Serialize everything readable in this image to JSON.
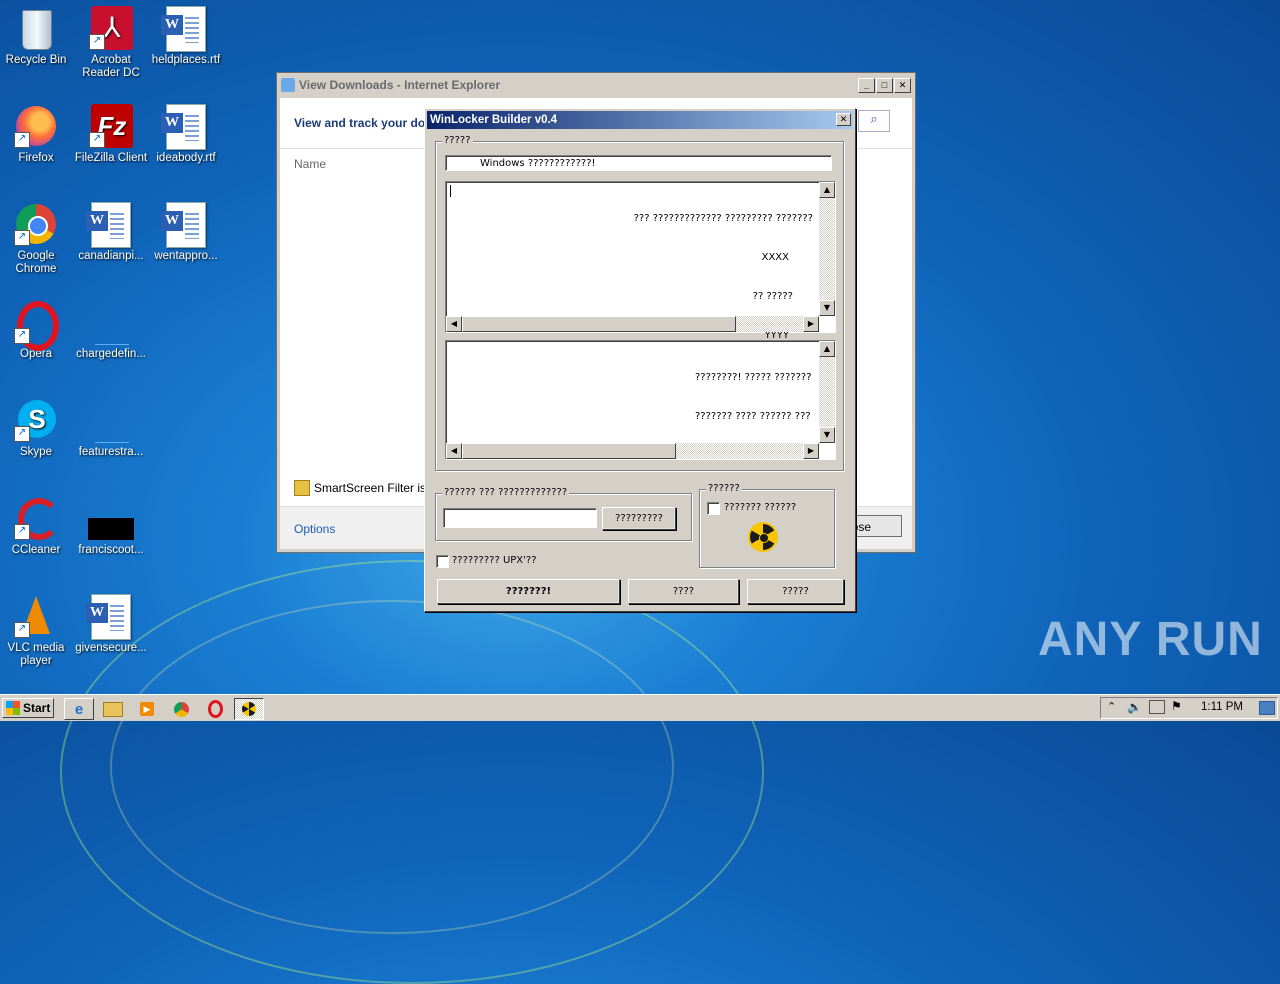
{
  "desktop": {
    "icons": [
      {
        "label": "Recycle Bin",
        "icon": "recycle-bin-icon"
      },
      {
        "label": "Acrobat Reader DC",
        "icon": "acrobat-icon"
      },
      {
        "label": "heldplaces.rtf",
        "icon": "word-document-icon"
      },
      {
        "label": "Firefox",
        "icon": "firefox-icon"
      },
      {
        "label": "FileZilla Client",
        "icon": "filezilla-icon"
      },
      {
        "label": "ideabody.rtf",
        "icon": "word-document-icon"
      },
      {
        "label": "Google Chrome",
        "icon": "chrome-icon"
      },
      {
        "label": "canadianpi...",
        "icon": "word-document-icon"
      },
      {
        "label": "wentappro...",
        "icon": "word-document-icon"
      },
      {
        "label": "Opera",
        "icon": "opera-icon"
      },
      {
        "label": "chargedefin...",
        "icon": "blank-file-icon"
      },
      {
        "label": "Skype",
        "icon": "skype-icon"
      },
      {
        "label": "featurestra...",
        "icon": "blank-file-icon"
      },
      {
        "label": "CCleaner",
        "icon": "ccleaner-icon"
      },
      {
        "label": "franciscoot...",
        "icon": "black-image-icon"
      },
      {
        "label": "VLC media player",
        "icon": "vlc-icon"
      },
      {
        "label": "givensecure...",
        "icon": "word-document-icon"
      }
    ],
    "watermark": "ANY RUN"
  },
  "ie_window": {
    "title": "View Downloads - Internet Explorer",
    "heading": "View and track your do",
    "column_name": "Name",
    "smartscreen": "SmartScreen Filter is",
    "options_link": "Options",
    "close_button": "ose"
  },
  "winlocker": {
    "title": "WinLocker Builder v0.4",
    "group_main_legend": "?????",
    "title_field_value": "Windows ????????????!",
    "message_lines": [
      "??? ????????????? ????????? ???????",
      "XXXX",
      "?? ?????",
      "YYYY",
      "? ????? ?? ???????? ????????? ? ???????"
    ],
    "footer_lines": [
      "????????! ????? ???????",
      "??????? ???? ?????? ???"
    ],
    "code_group_legend": "?????? ??? ?????????????",
    "code_input_value": "",
    "code_button": "?????????",
    "options_group_legend": "??????",
    "options_checkbox": "??????? ??????",
    "upx_checkbox": "????????? UPX'??",
    "build_button": "???????!",
    "button_two": "????",
    "button_three": "?????"
  },
  "taskbar": {
    "start_label": "Start",
    "clock": "1:11 PM"
  }
}
